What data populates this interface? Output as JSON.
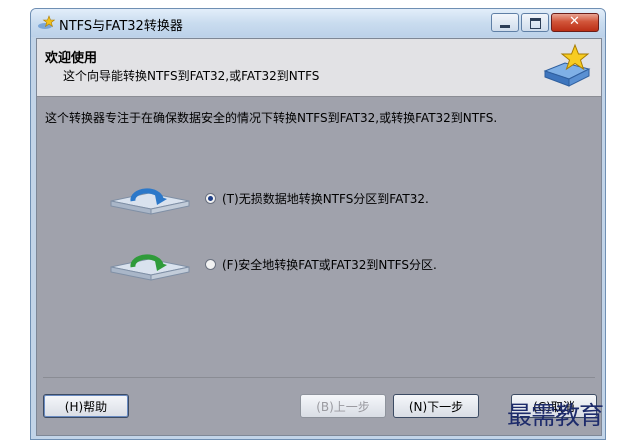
{
  "window": {
    "title": "NTFS与FAT32转换器"
  },
  "header": {
    "title": "欢迎使用",
    "subtitle": "这个向导能转换NTFS到FAT32,或FAT32到NTFS"
  },
  "main": {
    "description": "这个转换器专注于在确保数据安全的情况下转换NTFS到FAT32,或转换FAT32到NTFS.",
    "options": [
      {
        "label": "(T)无损数据地转换NTFS分区到FAT32.",
        "checked": true,
        "icon": "drive-convert-blue-icon"
      },
      {
        "label": "(F)安全地转换FAT或FAT32到NTFS分区.",
        "checked": false,
        "icon": "drive-convert-green-icon"
      }
    ]
  },
  "buttons": {
    "help": "(H)帮助",
    "back": "(B)上一步",
    "next": "(N)下一步",
    "cancel": "(C)取消"
  },
  "watermark": "最需教育",
  "colors": {
    "client_bg": "#a0a2ac",
    "header_bg": "#e2e2e5",
    "close_button": "#c9432a"
  }
}
